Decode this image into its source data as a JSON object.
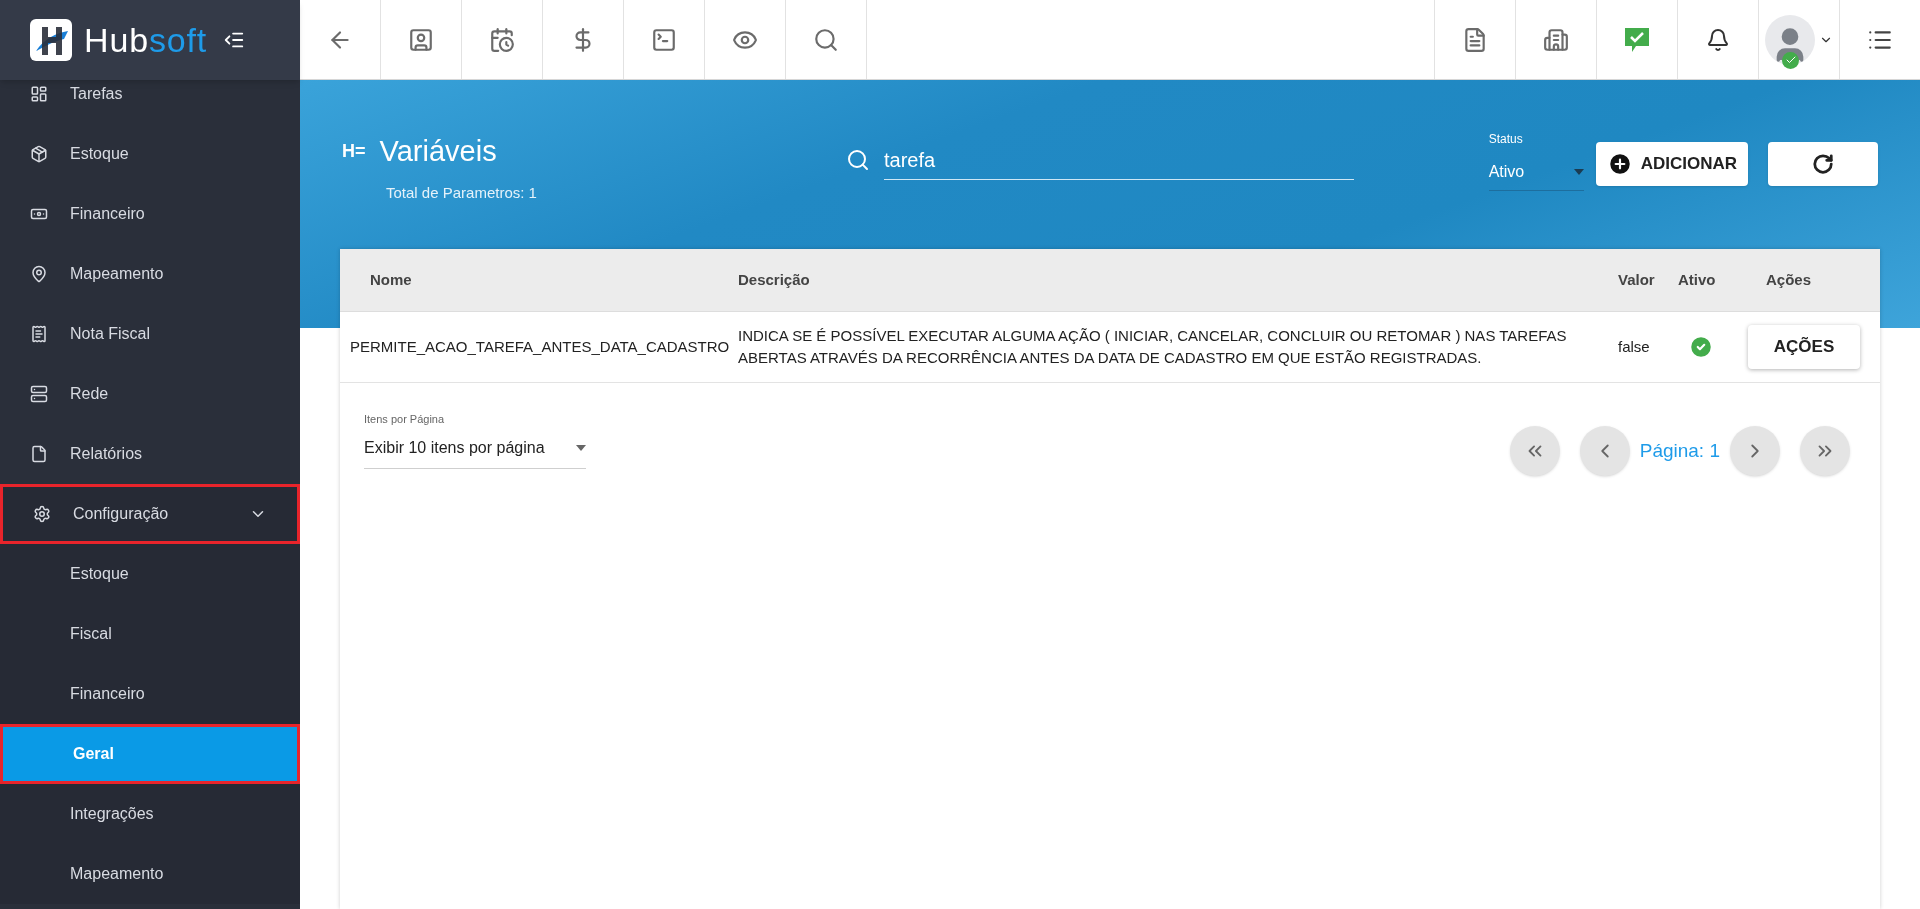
{
  "brand": {
    "part_1": "Hub",
    "part_2": "soft"
  },
  "sidebar": {
    "items": [
      {
        "label": "Tarefas",
        "highlighted": false
      },
      {
        "label": "Estoque",
        "highlighted": false
      },
      {
        "label": "Financeiro",
        "highlighted": false
      },
      {
        "label": "Mapeamento",
        "highlighted": false
      },
      {
        "label": "Nota Fiscal",
        "highlighted": false
      },
      {
        "label": "Rede",
        "highlighted": false
      },
      {
        "label": "Relatórios",
        "highlighted": false
      },
      {
        "label": "Configuração",
        "highlighted": true,
        "expanded": true,
        "children": [
          {
            "label": "Estoque",
            "selected": false,
            "highlighted": false
          },
          {
            "label": "Fiscal",
            "selected": false,
            "highlighted": false
          },
          {
            "label": "Financeiro",
            "selected": false,
            "highlighted": false
          },
          {
            "label": "Geral",
            "selected": true,
            "highlighted": true
          },
          {
            "label": "Integrações",
            "selected": false,
            "highlighted": false
          },
          {
            "label": "Mapeamento",
            "selected": false,
            "highlighted": false
          }
        ]
      }
    ]
  },
  "page": {
    "badge": "H=",
    "title": "Variáveis",
    "subtitle": "Total de Parametros: 1",
    "search": {
      "value": "tarefa"
    },
    "status": {
      "label": "Status",
      "value": "Ativo"
    },
    "add_button": "ADICIONAR"
  },
  "table": {
    "columns": [
      "Nome",
      "Descrição",
      "Valor",
      "Ativo",
      "Ações"
    ],
    "rows": [
      {
        "nome": "PERMITE_ACAO_TAREFA_ANTES_DATA_CADASTRO",
        "descricao": "INDICA SE É POSSÍVEL EXECUTAR ALGUMA AÇÃO ( INICIAR, CANCELAR, CONCLUIR OU RETOMAR ) NAS TAREFAS ABERTAS ATRAVÉS DA RECORRÊNCIA ANTES DA DATA DE CADASTRO EM QUE ESTÃO REGISTRADAS.",
        "valor": "false",
        "ativo": true,
        "acoes": "AÇÕES"
      }
    ]
  },
  "pagination": {
    "per_page_label": "Itens por Página",
    "per_page_value": "Exibir 10 itens por página",
    "page": "Página: 1"
  }
}
